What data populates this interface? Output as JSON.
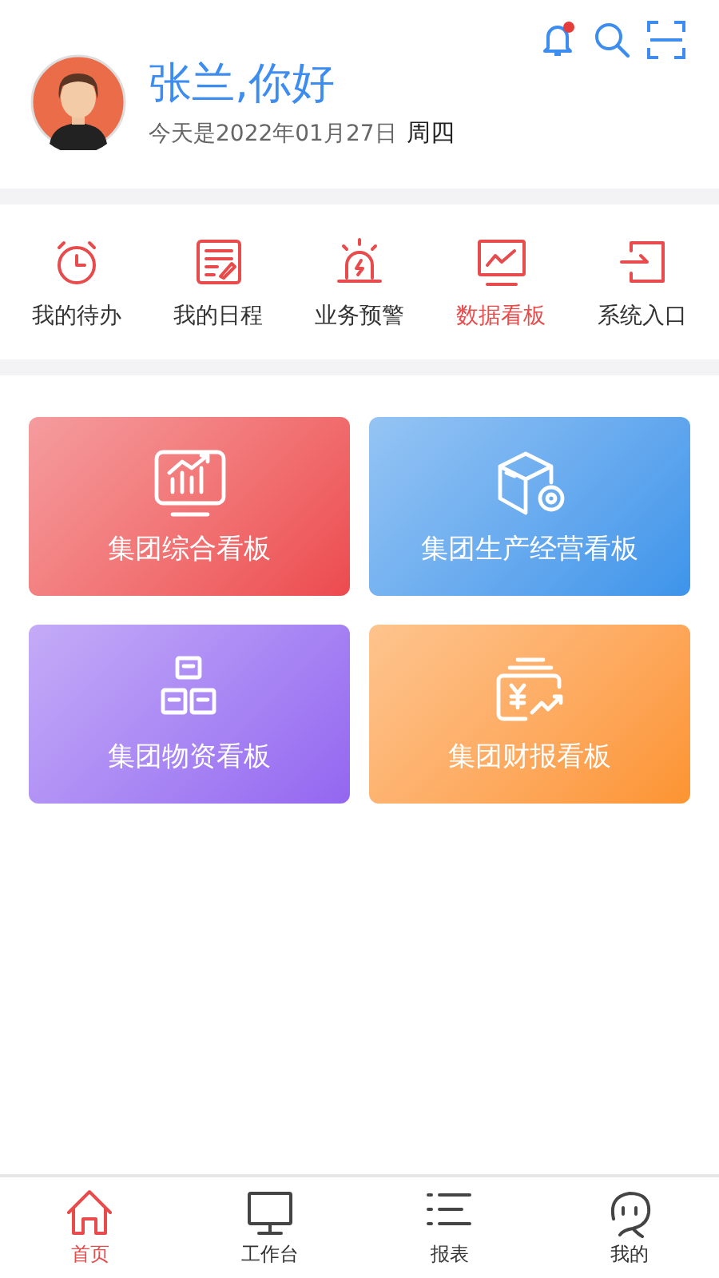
{
  "header": {
    "greeting": "张兰,你好",
    "date": "今天是2022年01月27日",
    "weekday": "周四",
    "notification_badge": true
  },
  "quick_menu": [
    {
      "label": "我的待办",
      "kind": "clock",
      "selected": false
    },
    {
      "label": "我的日程",
      "kind": "note",
      "selected": false
    },
    {
      "label": "业务预警",
      "kind": "alarm",
      "selected": false
    },
    {
      "label": "数据看板",
      "kind": "monitor",
      "selected": true
    },
    {
      "label": "系统入口",
      "kind": "enter",
      "selected": false
    }
  ],
  "boards": [
    {
      "label": "集团综合看板",
      "kind": "chart",
      "color": "#ec4a4f"
    },
    {
      "label": "集团生产经营看板",
      "kind": "box",
      "color": "#3d94ea"
    },
    {
      "label": "集团物资看板",
      "kind": "blocks",
      "color": "#9466f0"
    },
    {
      "label": "集团财报看板",
      "kind": "money",
      "color": "#fc9430"
    }
  ],
  "tab_bar": [
    {
      "label": "首页",
      "kind": "home",
      "selected": true
    },
    {
      "label": "工作台",
      "kind": "desktop",
      "selected": false
    },
    {
      "label": "报表",
      "kind": "list",
      "selected": false
    },
    {
      "label": "我的",
      "kind": "face",
      "selected": false
    }
  ]
}
